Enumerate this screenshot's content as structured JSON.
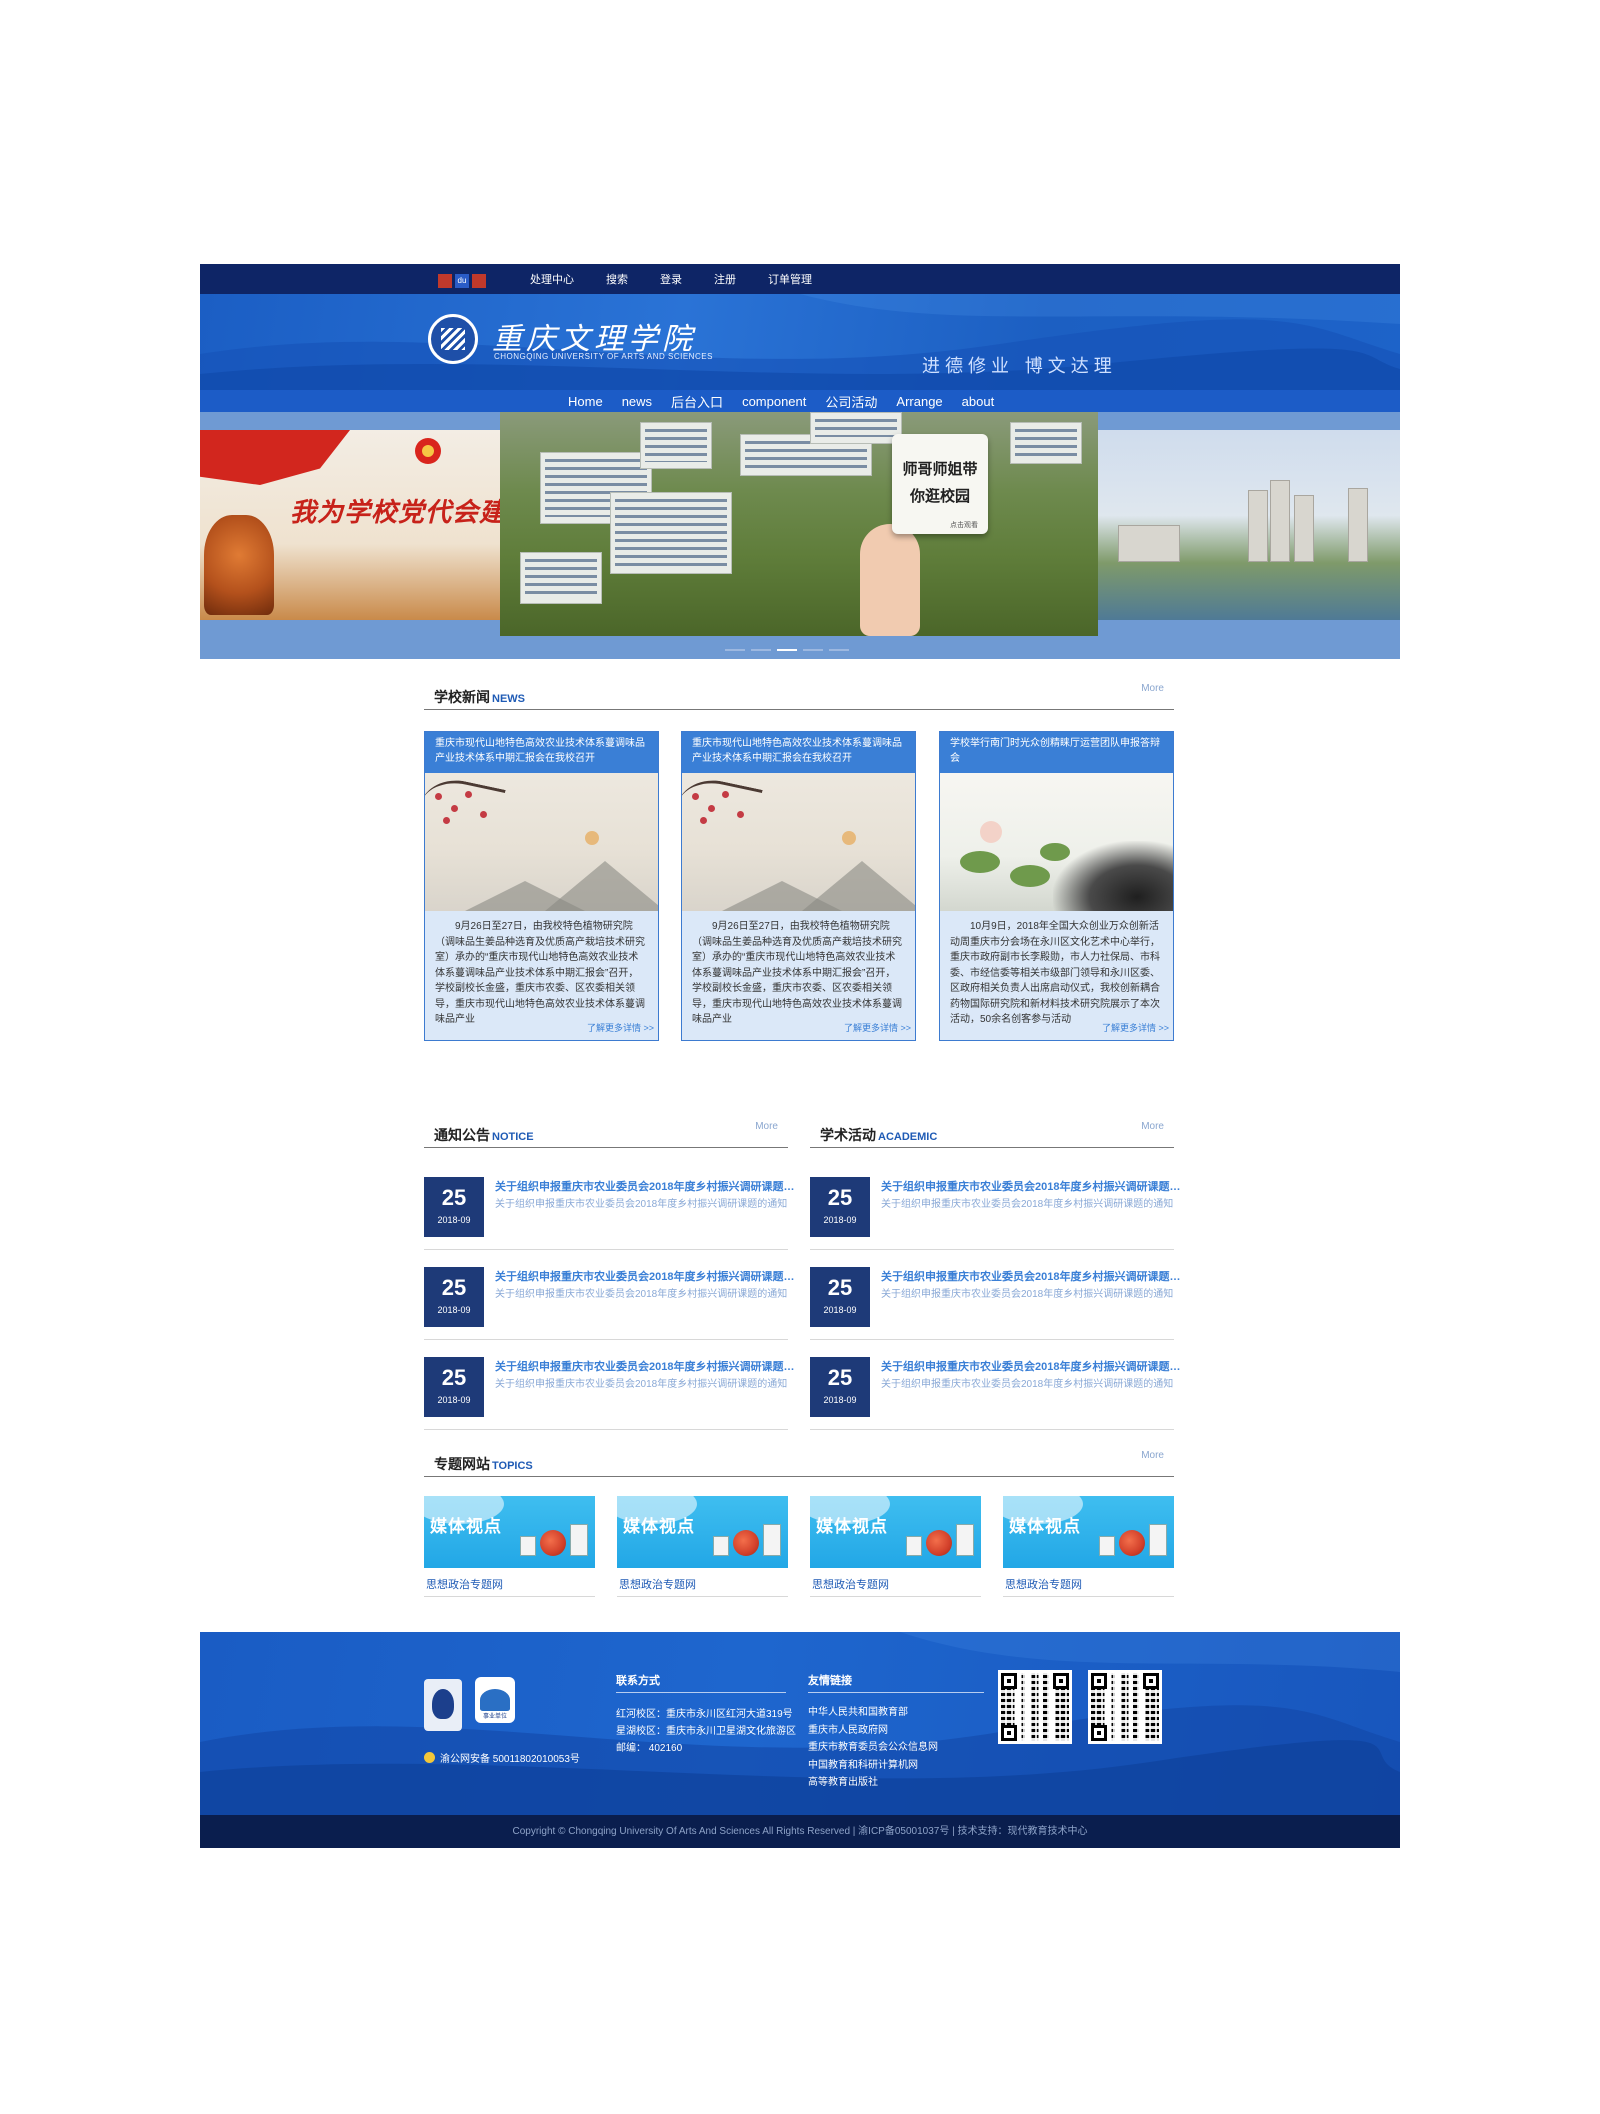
{
  "topbar": {
    "logo_text": "du",
    "links": [
      "处理中心",
      "搜索",
      "登录",
      "注册",
      "订单管理"
    ]
  },
  "header": {
    "school_name_cn": "重庆文理学院",
    "school_name_en": "CHONGQING UNIVERSITY OF ARTS AND SCIENCES",
    "motto": "进德修业 博文达理"
  },
  "nav": {
    "items": [
      "Home",
      "news",
      "后台入口",
      "component",
      "公司活动",
      "Arrange",
      "about"
    ]
  },
  "banner": {
    "left_slogan": "我为学校党代会建",
    "card_line1": "师哥师姐带",
    "card_line2": "你逛校园",
    "card_sign": "点击观看",
    "active_dot": 3,
    "dots": 5
  },
  "news": {
    "title": "学校新闻",
    "title_en": "NEWS",
    "more": "More",
    "items": [
      {
        "title": "重庆市现代山地特色高效农业技术体系蔓调味品产业技术体系中期汇报会在我校召开",
        "body": "9月26日至27日，由我校特色植物研究院（调味品生姜品种选育及优质高产栽培技术研究室）承办的“重庆市现代山地特色高效农业技术体系蔓调味品产业技术体系中期汇报会”召开，学校副校长金盛，重庆市农委、区农委相关领导，重庆市现代山地特色高效农业技术体系蔓调味品产业",
        "readmore": "了解更多详情 >>"
      },
      {
        "title": "重庆市现代山地特色高效农业技术体系蔓调味品产业技术体系中期汇报会在我校召开",
        "body": "9月26日至27日，由我校特色植物研究院（调味品生姜品种选育及优质高产栽培技术研究室）承办的“重庆市现代山地特色高效农业技术体系蔓调味品产业技术体系中期汇报会”召开，学校副校长金盛，重庆市农委、区农委相关领导，重庆市现代山地特色高效农业技术体系蔓调味品产业",
        "readmore": "了解更多详情 >>"
      },
      {
        "title": "学校举行南门时光众创精睐厅运营团队申报答辩会",
        "body": "10月9日，2018年全国大众创业万众创新活动周重庆市分会场在永川区文化艺术中心举行，重庆市政府副市长李殿勋，市人力社保局、市科委、市经信委等相关市级部门领导和永川区委、区政府相关负责人出席启动仪式，我校创新耦合药物国际研究院和新材料技术研究院展示了本次活动，50余名创客参与活动",
        "readmore": "了解更多详情 >>"
      }
    ]
  },
  "notice": {
    "title": "通知公告",
    "title_en": "NOTICE",
    "more": "More",
    "items": [
      {
        "day": "25",
        "month": "2018-09",
        "title": "关于组织申报重庆市农业委员会2018年度乡村振兴调研课题的通知",
        "desc": "关于组织申报重庆市农业委员会2018年度乡村振兴调研课题的通知"
      },
      {
        "day": "25",
        "month": "2018-09",
        "title": "关于组织申报重庆市农业委员会2018年度乡村振兴调研课题的通知",
        "desc": "关于组织申报重庆市农业委员会2018年度乡村振兴调研课题的通知"
      },
      {
        "day": "25",
        "month": "2018-09",
        "title": "关于组织申报重庆市农业委员会2018年度乡村振兴调研课题的通知",
        "desc": "关于组织申报重庆市农业委员会2018年度乡村振兴调研课题的通知"
      }
    ]
  },
  "academic": {
    "title": "学术活动",
    "title_en": "ACADEMIC",
    "more": "More",
    "items": [
      {
        "day": "25",
        "month": "2018-09",
        "title": "关于组织申报重庆市农业委员会2018年度乡村振兴调研课题的通知",
        "desc": "关于组织申报重庆市农业委员会2018年度乡村振兴调研课题的通知"
      },
      {
        "day": "25",
        "month": "2018-09",
        "title": "关于组织申报重庆市农业委员会2018年度乡村振兴调研课题的通知",
        "desc": "关于组织申报重庆市农业委员会2018年度乡村振兴调研课题的通知"
      },
      {
        "day": "25",
        "month": "2018-09",
        "title": "关于组织申报重庆市农业委员会2018年度乡村振兴调研课题的通知",
        "desc": "关于组织申报重庆市农业委员会2018年度乡村振兴调研课题的通知"
      }
    ]
  },
  "topics": {
    "title": "专题网站",
    "title_en": "TOPICS",
    "more": "More",
    "items": [
      {
        "banner_text": "媒体视点",
        "caption": "思想政治专题网"
      },
      {
        "banner_text": "媒体视点",
        "caption": "思想政治专题网"
      },
      {
        "banner_text": "媒体视点",
        "caption": "思想政治专题网"
      },
      {
        "banner_text": "媒体视点",
        "caption": "思想政治专题网"
      }
    ]
  },
  "footer": {
    "police_record": "渝公网安备 50011802010053号",
    "contact_title": "联系方式",
    "contact_lines": [
      "红河校区：重庆市永川区红河大道319号",
      "星湖校区：重庆市永川卫星湖文化旅游区",
      "邮编： 402160"
    ],
    "links_title": "友情链接",
    "links": [
      "中华人民共和国教育部",
      "重庆市人民政府网",
      "重庆市教育委员会公众信息网",
      "中国教育和科研计算机网",
      "高等教育出版社"
    ],
    "badge2_text": "事业单位",
    "copyright": "Copyright © Chongqing University Of Arts And Sciences All Rights Reserved | 渝ICP备05001037号 | 技术支持：现代教育技术中心"
  }
}
